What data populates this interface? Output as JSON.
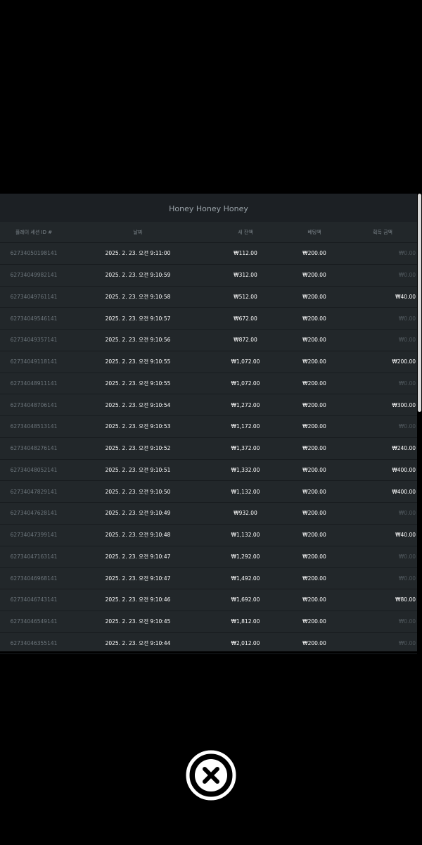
{
  "panel": {
    "title": "Honey Honey Honey"
  },
  "table": {
    "headers": {
      "session_id": "플레이 세션 ID #",
      "date": "날짜",
      "new_balance": "새 잔액",
      "bet_amount": "베팅액",
      "win_amount": "획득 금액"
    },
    "rows": [
      {
        "id": "62734050198141",
        "date": "2025. 2. 23. 오전 9:11:00",
        "balance": "₩112.00",
        "bet": "₩200.00",
        "win": "₩0.00"
      },
      {
        "id": "62734049982141",
        "date": "2025. 2. 23. 오전 9:10:59",
        "balance": "₩312.00",
        "bet": "₩200.00",
        "win": "₩0.00"
      },
      {
        "id": "62734049761141",
        "date": "2025. 2. 23. 오전 9:10:58",
        "balance": "₩512.00",
        "bet": "₩200.00",
        "win": "₩40.00"
      },
      {
        "id": "62734049546141",
        "date": "2025. 2. 23. 오전 9:10:57",
        "balance": "₩672.00",
        "bet": "₩200.00",
        "win": "₩0.00"
      },
      {
        "id": "62734049357141",
        "date": "2025. 2. 23. 오전 9:10:56",
        "balance": "₩872.00",
        "bet": "₩200.00",
        "win": "₩0.00"
      },
      {
        "id": "62734049118141",
        "date": "2025. 2. 23. 오전 9:10:55",
        "balance": "₩1,072.00",
        "bet": "₩200.00",
        "win": "₩200.00"
      },
      {
        "id": "62734048911141",
        "date": "2025. 2. 23. 오전 9:10:55",
        "balance": "₩1,072.00",
        "bet": "₩200.00",
        "win": "₩0.00"
      },
      {
        "id": "62734048706141",
        "date": "2025. 2. 23. 오전 9:10:54",
        "balance": "₩1,272.00",
        "bet": "₩200.00",
        "win": "₩300.00"
      },
      {
        "id": "62734048513141",
        "date": "2025. 2. 23. 오전 9:10:53",
        "balance": "₩1,172.00",
        "bet": "₩200.00",
        "win": "₩0.00"
      },
      {
        "id": "62734048276141",
        "date": "2025. 2. 23. 오전 9:10:52",
        "balance": "₩1,372.00",
        "bet": "₩200.00",
        "win": "₩240.00"
      },
      {
        "id": "62734048052141",
        "date": "2025. 2. 23. 오전 9:10:51",
        "balance": "₩1,332.00",
        "bet": "₩200.00",
        "win": "₩400.00"
      },
      {
        "id": "62734047829141",
        "date": "2025. 2. 23. 오전 9:10:50",
        "balance": "₩1,132.00",
        "bet": "₩200.00",
        "win": "₩400.00"
      },
      {
        "id": "62734047628141",
        "date": "2025. 2. 23. 오전 9:10:49",
        "balance": "₩932.00",
        "bet": "₩200.00",
        "win": "₩0.00"
      },
      {
        "id": "62734047399141",
        "date": "2025. 2. 23. 오전 9:10:48",
        "balance": "₩1,132.00",
        "bet": "₩200.00",
        "win": "₩40.00"
      },
      {
        "id": "62734047163141",
        "date": "2025. 2. 23. 오전 9:10:47",
        "balance": "₩1,292.00",
        "bet": "₩200.00",
        "win": "₩0.00"
      },
      {
        "id": "62734046968141",
        "date": "2025. 2. 23. 오전 9:10:47",
        "balance": "₩1,492.00",
        "bet": "₩200.00",
        "win": "₩0.00"
      },
      {
        "id": "62734046743141",
        "date": "2025. 2. 23. 오전 9:10:46",
        "balance": "₩1,692.00",
        "bet": "₩200.00",
        "win": "₩80.00"
      },
      {
        "id": "62734046549141",
        "date": "2025. 2. 23. 오전 9:10:45",
        "balance": "₩1,812.00",
        "bet": "₩200.00",
        "win": "₩0.00"
      },
      {
        "id": "62734046355141",
        "date": "2025. 2. 23. 오전 9:10:44",
        "balance": "₩2,012.00",
        "bet": "₩200.00",
        "win": "₩0.00"
      }
    ]
  },
  "close_button": {
    "icon": "close-circle-icon"
  },
  "colors": {
    "background": "#000000",
    "panel": "#22272a",
    "panel_title_bar": "#1c2024",
    "zero_win": "#4f575c",
    "text_primary": "#ffffff",
    "text_muted": "#6c757b"
  }
}
